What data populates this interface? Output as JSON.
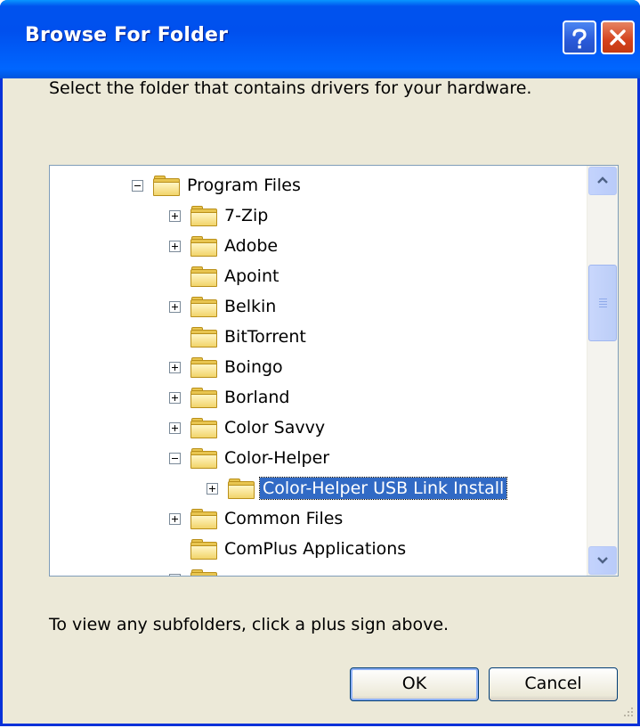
{
  "window": {
    "title": "Browse For Folder",
    "help_label": "?",
    "colors": {
      "title_bar": "#0053ee",
      "close_button": "#d4421d",
      "body": "#ece9d8",
      "selection": "#316ac5"
    }
  },
  "instruction": "Select the folder that contains drivers for your hardware.",
  "tree": {
    "items": [
      {
        "label": "Program Files",
        "expander": "minus",
        "level": 0
      },
      {
        "label": "7-Zip",
        "expander": "plus",
        "level": 1
      },
      {
        "label": "Adobe",
        "expander": "plus",
        "level": 1
      },
      {
        "label": "Apoint",
        "expander": "none",
        "level": 1
      },
      {
        "label": "Belkin",
        "expander": "plus",
        "level": 1
      },
      {
        "label": "BitTorrent",
        "expander": "none",
        "level": 1
      },
      {
        "label": "Boingo",
        "expander": "plus",
        "level": 1
      },
      {
        "label": "Borland",
        "expander": "plus",
        "level": 1
      },
      {
        "label": "Color Savvy",
        "expander": "plus",
        "level": 1
      },
      {
        "label": "Color-Helper",
        "expander": "minus",
        "level": 1
      },
      {
        "label": "Color-Helper USB Link Install",
        "expander": "plus",
        "level": 2,
        "selected": true
      },
      {
        "label": "Common Files",
        "expander": "plus",
        "level": 1
      },
      {
        "label": "ComPlus Applications",
        "expander": "none",
        "level": 1
      }
    ],
    "scroll_position": 0.25
  },
  "hint": "To view any subfolders, click a plus sign above.",
  "buttons": {
    "ok": "OK",
    "cancel": "Cancel"
  },
  "icons": [
    "help-icon",
    "close-icon",
    "folder-icon",
    "scroll-up-arrow-icon",
    "scroll-down-arrow-icon",
    "resize-grip-icon"
  ]
}
